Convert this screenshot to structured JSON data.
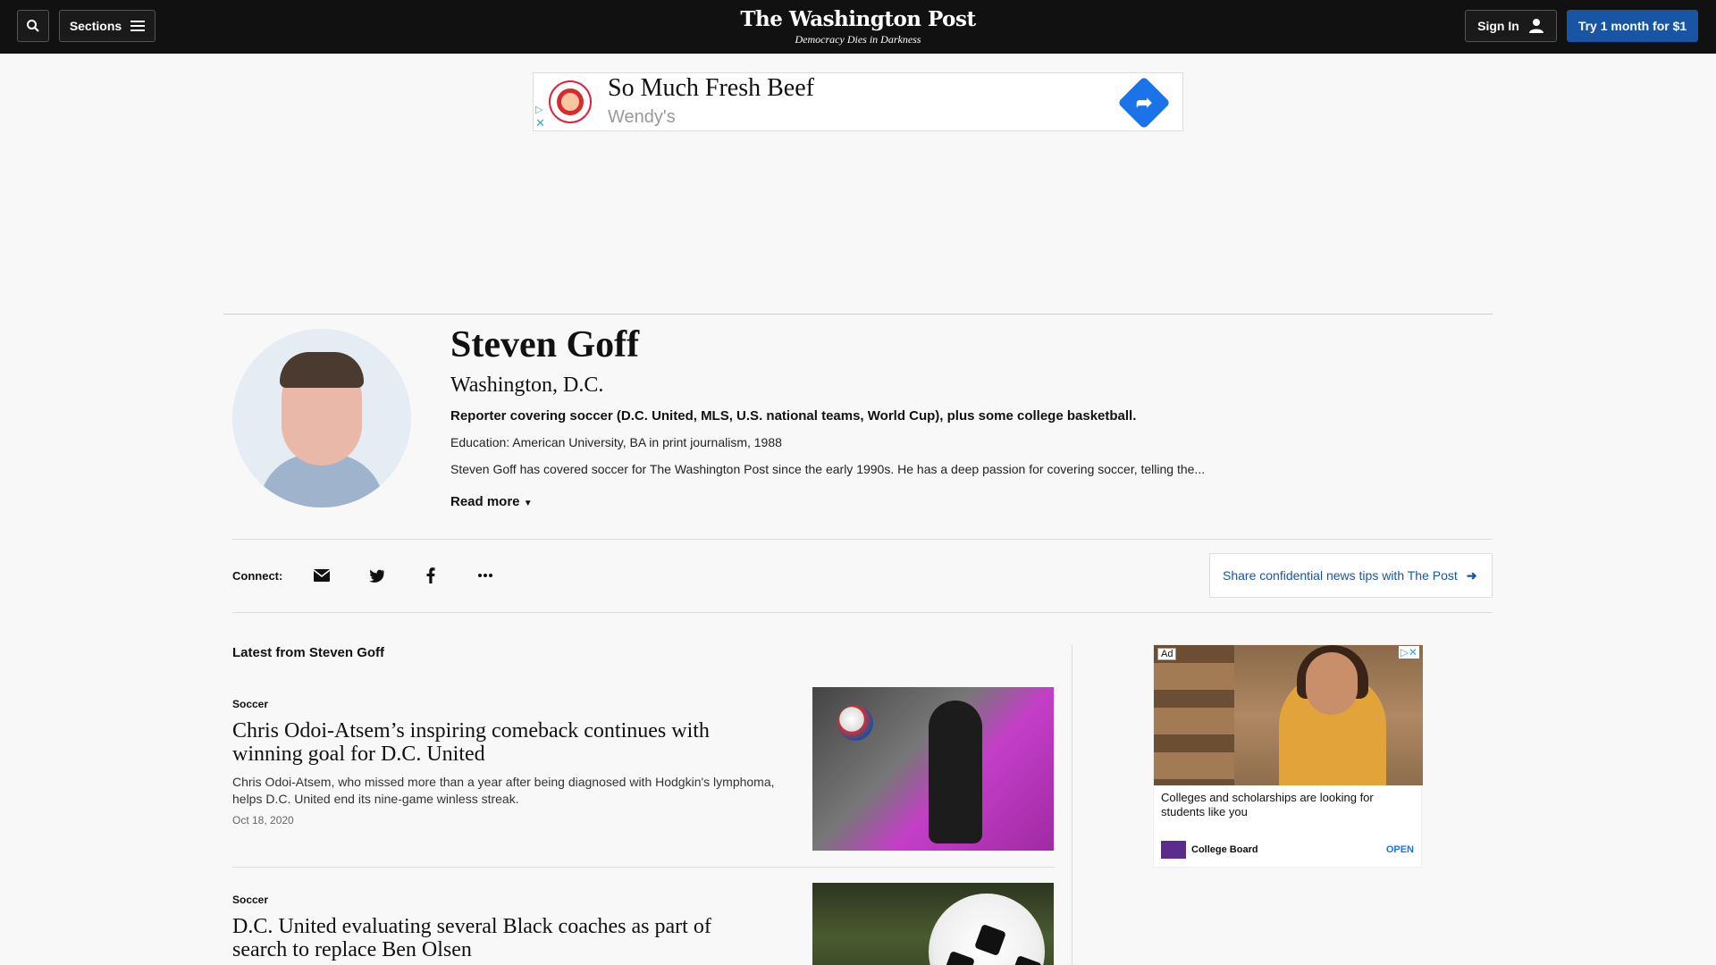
{
  "header": {
    "sections_label": "Sections",
    "logo_name": "The Washington Post",
    "logo_tagline": "Democracy Dies in Darkness",
    "sign_in_label": "Sign In",
    "subscribe_label": "Try 1 month for $1",
    "accent_color": "#1955a5"
  },
  "ad_top": {
    "headline": "So Much Fresh Beef",
    "advertiser": "Wendy's"
  },
  "author": {
    "name": "Steven Goff",
    "location": "Washington, D.C.",
    "role": "Reporter covering soccer (D.C. United, MLS, U.S. national teams, World Cup), plus some college basketball.",
    "education": "Education: American University, BA in print journalism, 1988",
    "bio": "Steven Goff has covered soccer for The Washington Post since the early 1990s. He has a deep passion for covering soccer, telling the...",
    "read_more": "Read more"
  },
  "connect": {
    "label": "Connect:",
    "icons": [
      "email-icon",
      "twitter-icon",
      "facebook-icon",
      "more-icon"
    ],
    "tips_label": "Share confidential news tips with The Post"
  },
  "latest": {
    "title": "Latest from Steven Goff",
    "articles": [
      {
        "kicker": "Soccer",
        "headline": "Chris Odoi-Atsem’s inspiring comeback continues with winning goal for D.C. United",
        "blurb": "Chris Odoi-Atsem, who missed more than a year after being diagnosed with Hodgkin's lymphoma, helps D.C. United end its nine-game winless streak.",
        "date": "Oct 18, 2020"
      },
      {
        "kicker": "Soccer",
        "headline": "D.C. United evaluating several Black coaches as part of search to replace Ben Olsen"
      }
    ]
  },
  "side_ad": {
    "badge": "Ad",
    "text": "Colleges and scholarships are looking for students like you",
    "brand": "College Board",
    "cta": "OPEN"
  }
}
